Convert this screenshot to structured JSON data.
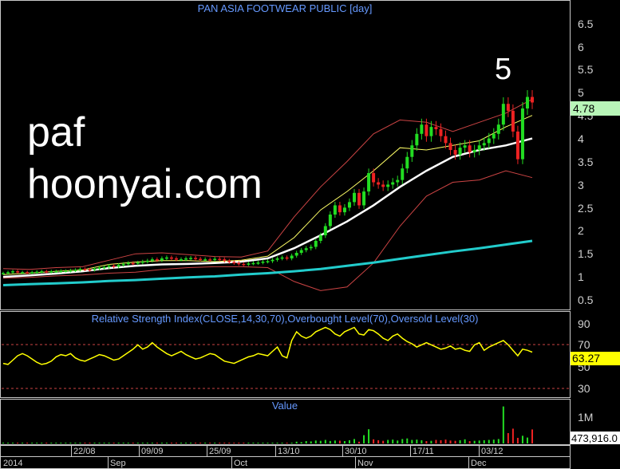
{
  "title": "PAN ASIA FOOTWEAR PUBLIC [day]",
  "watermark": {
    "line1": "paf",
    "line2": "hoonyai.com"
  },
  "annotation": "5",
  "price_axis": {
    "ticks": [
      "6.5",
      "6",
      "5.5",
      "5",
      "4.5",
      "4",
      "3.5",
      "3",
      "2.5",
      "2",
      "1.5",
      "1",
      "0.5"
    ],
    "last_label": "4.78"
  },
  "rsi": {
    "title": "Relative Strength Index(CLOSE,14,30,70),Overbought Level(70),Oversold Level(30)",
    "ticks": [
      "90",
      "70",
      "50",
      "30"
    ],
    "last_label": "63.27",
    "overbought": 70,
    "oversold": 30
  },
  "volume": {
    "title": "Value",
    "ticks": [
      "1M"
    ],
    "last_label": "473,916.0"
  },
  "date_axis": {
    "top": [
      "22/08",
      "09/09",
      "25/09",
      "13/10",
      "30/10",
      "17/11",
      "03/12"
    ],
    "bottom": [
      "2014",
      "Sep",
      "Oct",
      "Nov",
      "Dec"
    ]
  },
  "colors": {
    "background": "#000000",
    "up": "#22dd22",
    "down": "#ee2222",
    "rsi": "#ffff00",
    "ma_long": "#22cccc",
    "ma_mid": "#ffffff",
    "ma_short": "#ffff66",
    "bollinger": "#cc4444",
    "axis_text": "#d0d0d0",
    "title_text": "#6699ff"
  },
  "chart_data": [
    {
      "type": "candlestick",
      "title": "PAN ASIA FOOTWEAR PUBLIC [day]",
      "ylim": [
        0.25,
        7.0
      ],
      "close": [
        1.08,
        1.1,
        1.12,
        1.1,
        1.1,
        1.09,
        1.1,
        1.11,
        1.12,
        1.11,
        1.12,
        1.12,
        1.13,
        1.13,
        1.14,
        1.15,
        1.17,
        1.16,
        1.15,
        1.18,
        1.2,
        1.21,
        1.24,
        1.22,
        1.26,
        1.28,
        1.3,
        1.29,
        1.31,
        1.33,
        1.35,
        1.38,
        1.36,
        1.4,
        1.42,
        1.4,
        1.38,
        1.38,
        1.4,
        1.41,
        1.39,
        1.38,
        1.38,
        1.37,
        1.39,
        1.38,
        1.35,
        1.32,
        1.3,
        1.28,
        1.27,
        1.29,
        1.3,
        1.31,
        1.33,
        1.34,
        1.37,
        1.4,
        1.42,
        1.4,
        1.46,
        1.52,
        1.58,
        1.62,
        1.65,
        1.78,
        1.9,
        2.1,
        2.35,
        2.55,
        2.4,
        2.5,
        2.62,
        2.82,
        2.55,
        2.85,
        3.25,
        3.05,
        3.0,
        2.95,
        3.0,
        3.05,
        3.1,
        3.35,
        3.6,
        3.85,
        4.1,
        4.3,
        4.05,
        4.25,
        4.2,
        4.05,
        3.9,
        3.75,
        3.65,
        3.8,
        3.85,
        3.7,
        3.75,
        3.85,
        3.9,
        4.0,
        4.1,
        4.3,
        4.75,
        4.6,
        4.15,
        3.55,
        4.65,
        4.9,
        4.78
      ],
      "ma_long": [
        0.82,
        0.84,
        0.86,
        0.88,
        0.91,
        0.93,
        0.96,
        0.99,
        1.01,
        1.05,
        1.08,
        1.12,
        1.17,
        1.24,
        1.31,
        1.39,
        1.47,
        1.55,
        1.62,
        1.7,
        1.78
      ],
      "ma_mid": [
        1.0,
        1.03,
        1.07,
        1.12,
        1.19,
        1.24,
        1.27,
        1.28,
        1.3,
        1.33,
        1.4,
        1.62,
        1.9,
        2.2,
        2.55,
        2.95,
        3.3,
        3.6,
        3.75,
        3.85,
        4.0
      ],
      "ma_short": [
        1.05,
        1.08,
        1.12,
        1.15,
        1.27,
        1.32,
        1.35,
        1.35,
        1.33,
        1.36,
        1.45,
        1.85,
        2.45,
        2.85,
        3.3,
        3.8,
        3.75,
        3.85,
        3.95,
        4.25,
        4.5
      ],
      "bb_upper": [
        1.18,
        1.16,
        1.2,
        1.22,
        1.36,
        1.5,
        1.52,
        1.48,
        1.44,
        1.43,
        1.56,
        2.3,
        2.95,
        3.5,
        4.1,
        4.4,
        4.35,
        4.15,
        4.35,
        4.55,
        4.85
      ],
      "bb_lower": [
        0.97,
        0.99,
        1.02,
        1.04,
        1.08,
        1.1,
        1.16,
        1.2,
        1.22,
        1.22,
        1.2,
        0.9,
        0.7,
        0.78,
        1.3,
        2.1,
        2.75,
        3.05,
        3.1,
        3.3,
        3.15
      ]
    },
    {
      "type": "line",
      "title": "Relative Strength Index(CLOSE,14,30,70),Overbought Level(70),Oversold Level(30)",
      "ylim": [
        20,
        95
      ],
      "values": [
        53,
        52,
        56,
        60,
        62,
        60,
        57,
        54,
        52,
        53,
        55,
        59,
        61,
        60,
        62,
        58,
        56,
        55,
        57,
        59,
        61,
        60,
        58,
        56,
        57,
        60,
        63,
        66,
        70,
        66,
        68,
        72,
        68,
        65,
        62,
        60,
        62,
        64,
        61,
        59,
        57,
        58,
        60,
        62,
        61,
        58,
        55,
        54,
        53,
        55,
        57,
        59,
        60,
        62,
        61,
        60,
        64,
        68,
        60,
        58,
        74,
        82,
        78,
        76,
        78,
        82,
        84,
        86,
        84,
        80,
        78,
        82,
        84,
        86,
        80,
        79,
        84,
        83,
        80,
        76,
        74,
        78,
        80,
        76,
        73,
        71,
        68,
        70,
        72,
        70,
        68,
        66,
        67,
        69,
        66,
        67,
        65,
        64,
        70,
        72,
        65,
        68,
        70,
        72,
        74,
        70,
        65,
        60,
        66,
        65,
        63.27
      ]
    },
    {
      "type": "bar",
      "title": "Value",
      "ylim": [
        0,
        1400000
      ],
      "values": [
        3000,
        2000,
        4000,
        3000,
        2000,
        3000,
        5000,
        4000,
        3000,
        6000,
        8000,
        12000,
        7000,
        5000,
        4000,
        3000,
        6000,
        10000,
        9000,
        8000,
        7000,
        6000,
        5000,
        4000,
        3000,
        5000,
        6000,
        7000,
        8000,
        9000,
        10000,
        8000,
        6000,
        5000,
        4000,
        6000,
        5000,
        4000,
        3000,
        2000,
        3000,
        5000,
        4000,
        3000,
        2000,
        3000,
        4000,
        5000,
        3000,
        2000,
        2500,
        3000,
        3500,
        4000,
        5000,
        6000,
        8000,
        12000,
        9000,
        7000,
        25000,
        60000,
        45000,
        80000,
        70000,
        100000,
        90000,
        120000,
        85000,
        100000,
        95000,
        80000,
        110000,
        150000,
        60000,
        280000,
        480000,
        140000,
        110000,
        90000,
        120000,
        130000,
        100000,
        150000,
        170000,
        120000,
        130000,
        110000,
        80000,
        90000,
        120000,
        110000,
        130000,
        100000,
        90000,
        110000,
        140000,
        80000,
        90000,
        100000,
        110000,
        120000,
        130000,
        150000,
        1250000,
        350000,
        500000,
        190000,
        260000,
        200000,
        473916
      ]
    }
  ]
}
